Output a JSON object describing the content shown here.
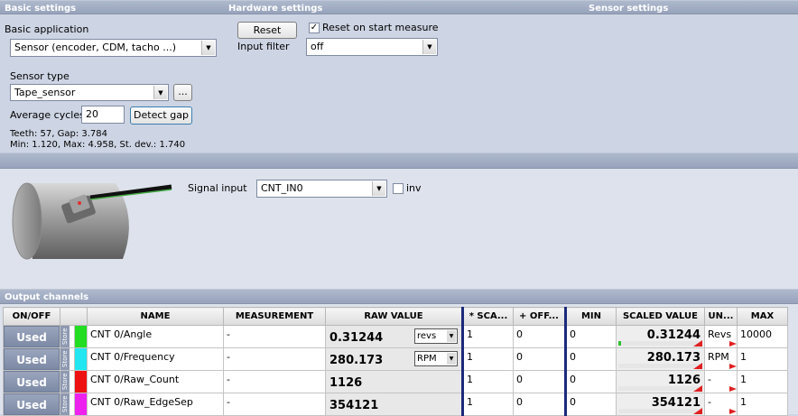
{
  "sections": {
    "basic": "Basic settings",
    "hardware": "Hardware settings",
    "sensor": "Sensor settings",
    "output": "Output channels"
  },
  "basic": {
    "app_label": "Basic application",
    "app_value": "Sensor (encoder, CDM, tacho ...)",
    "sensor_type_label": "Sensor type",
    "sensor_type_value": "Tape_sensor",
    "browse_label": "...",
    "avg_label": "Average cycles",
    "avg_value": "20",
    "detect_label": "Detect gap",
    "stats1": "Teeth: 57, Gap: 3.784",
    "stats2": "Min: 1.120, Max: 4.958, St. dev.: 1.740"
  },
  "hardware": {
    "reset_label": "Reset",
    "reset_start_label": "Reset on start measure",
    "reset_start_checked": "✓",
    "filter_label": "Input filter",
    "filter_value": "off"
  },
  "signal": {
    "label": "Signal input",
    "value": "CNT_IN0",
    "inv_label": "inv"
  },
  "table": {
    "headers": [
      "ON/OFF",
      "",
      "NAME",
      "MEASUREMENT",
      "RAW VALUE",
      "* SCA...",
      "+ OFF...",
      "MIN",
      "SCALED VALUE",
      "UN...",
      "MAX"
    ],
    "rows": [
      {
        "onoff": "Used",
        "store": "Store",
        "color": "#22dd22",
        "name": "CNT 0/Angle",
        "measurement": "-",
        "raw": "0.31244",
        "unit_sel": "revs",
        "scale": "1",
        "offset": "0",
        "min": "0",
        "scaled": "0.31244",
        "unit": "Revs",
        "max": "10000",
        "level": 0.03
      },
      {
        "onoff": "Used",
        "store": "Store",
        "color": "#22e6f0",
        "name": "CNT 0/Frequency",
        "measurement": "-",
        "raw": "280.173",
        "unit_sel": "RPM",
        "scale": "1",
        "offset": "0",
        "min": "0",
        "scaled": "280.173",
        "unit": "RPM",
        "max": "1",
        "level": 1
      },
      {
        "onoff": "Used",
        "store": "Store",
        "color": "#ee1111",
        "name": "CNT 0/Raw_Count",
        "measurement": "-",
        "raw": "1126",
        "unit_sel": "",
        "scale": "1",
        "offset": "0",
        "min": "0",
        "scaled": "1126",
        "unit": "-",
        "max": "1",
        "level": 1
      },
      {
        "onoff": "Used",
        "store": "Store",
        "color": "#ee22ee",
        "name": "CNT 0/Raw_EdgeSep",
        "measurement": "-",
        "raw": "354121",
        "unit_sel": "",
        "scale": "1",
        "offset": "0",
        "min": "0",
        "scaled": "354121",
        "unit": "-",
        "max": "1",
        "level": 1
      }
    ]
  }
}
